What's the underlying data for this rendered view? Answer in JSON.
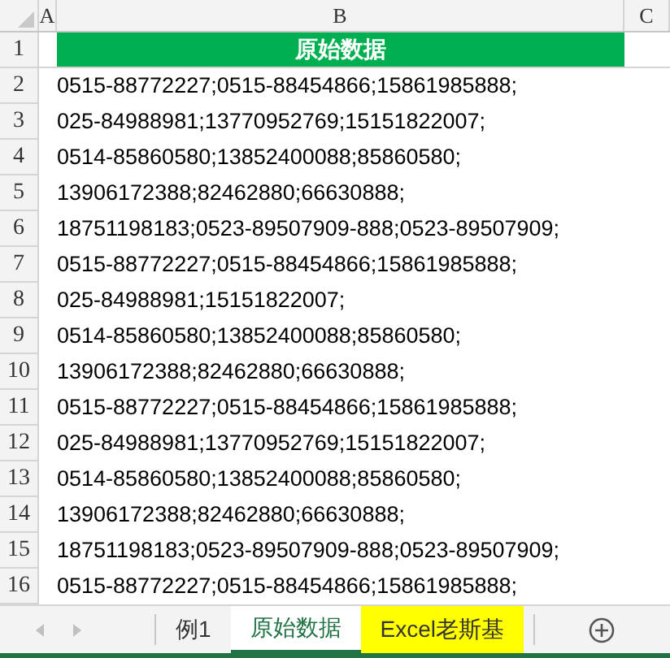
{
  "columns": [
    "A",
    "B",
    "C"
  ],
  "header_row": {
    "number": "1",
    "title": "原始数据"
  },
  "rows": [
    {
      "number": "2",
      "text": "0515-88772227;0515-88454866;15861985888;"
    },
    {
      "number": "3",
      "text": "025-84988981;13770952769;15151822007;"
    },
    {
      "number": "4",
      "text": "0514-85860580;13852400088;85860580;"
    },
    {
      "number": "5",
      "text": "13906172388;82462880;66630888;"
    },
    {
      "number": "6",
      "text": "18751198183;0523-89507909-888;0523-89507909;"
    },
    {
      "number": "7",
      "text": "0515-88772227;0515-88454866;15861985888;"
    },
    {
      "number": "8",
      "text": "025-84988981;15151822007;"
    },
    {
      "number": "9",
      "text": "0514-85860580;13852400088;85860580;"
    },
    {
      "number": "10",
      "text": "13906172388;82462880;66630888;"
    },
    {
      "number": "11",
      "text": "0515-88772227;0515-88454866;15861985888;"
    },
    {
      "number": "12",
      "text": "025-84988981;13770952769;15151822007;"
    },
    {
      "number": "13",
      "text": "0514-85860580;13852400088;85860580;"
    },
    {
      "number": "14",
      "text": "13906172388;82462880;66630888;"
    },
    {
      "number": "15",
      "text": "18751198183;0523-89507909-888;0523-89507909;"
    },
    {
      "number": "16",
      "text": "0515-88772227;0515-88454866;15861985888;"
    }
  ],
  "sheet_tabs": [
    {
      "label": "例1",
      "selected": false
    },
    {
      "label": "原始数据",
      "selected": true
    },
    {
      "label": "Excel老斯基",
      "selected": false,
      "color": "#ffff00"
    }
  ]
}
